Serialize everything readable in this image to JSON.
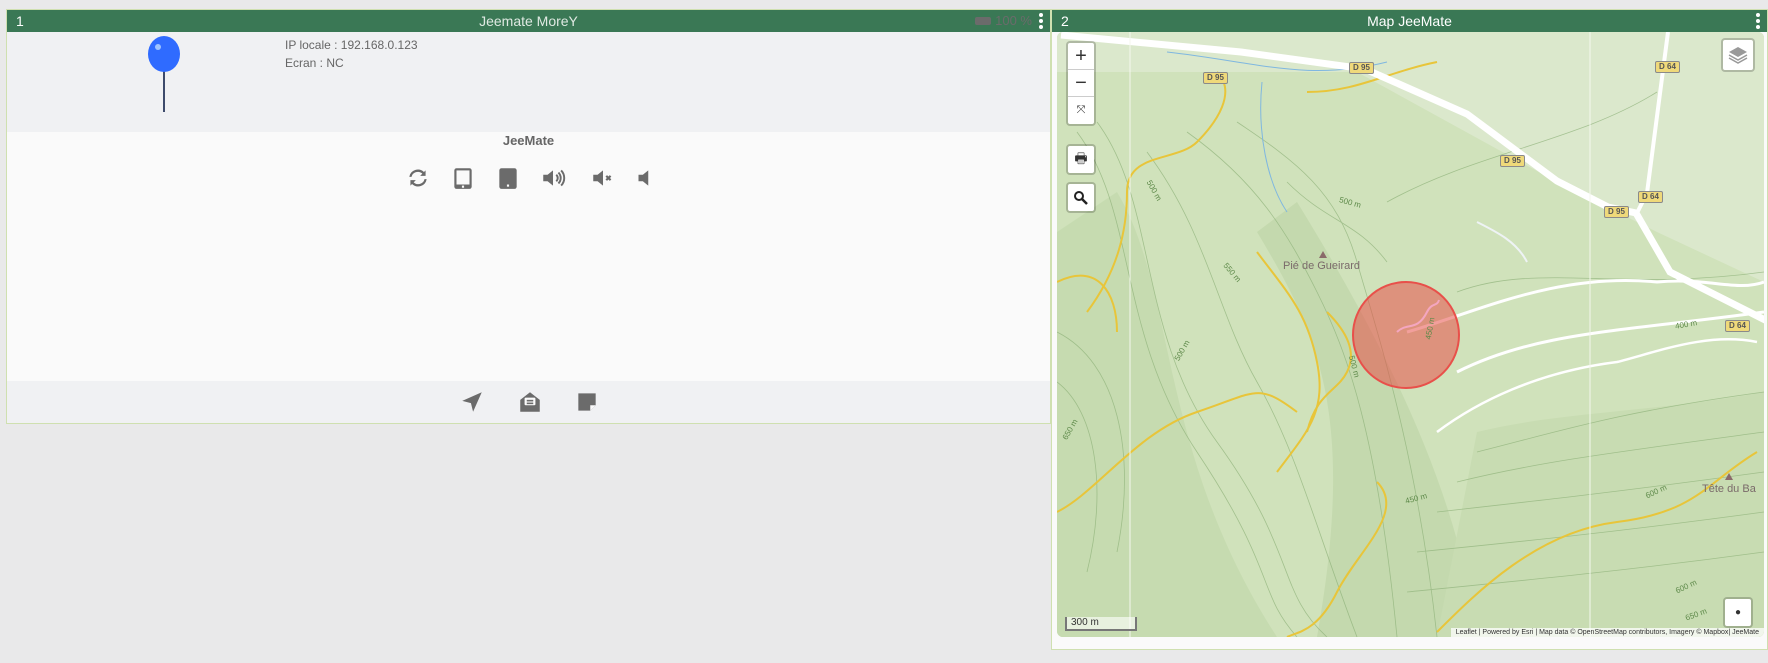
{
  "widget1": {
    "number": "1",
    "title": "Jeemate MoreY",
    "battery": "100 %",
    "ip_line": "IP locale : 192.168.0.123",
    "screen_line": "Ecran : NC",
    "section_title": "JeeMate",
    "actions": [
      "refresh-icon",
      "tablet-outline-icon",
      "tablet-icon",
      "volume-up-icon",
      "volume-mute-icon",
      "volume-off-icon"
    ],
    "footer_actions": [
      "location-arrow-icon",
      "envelope-open-text-icon",
      "sticky-note-icon"
    ],
    "pin_color": "#2f6bff"
  },
  "widget2": {
    "number": "2",
    "title": "Map JeeMate",
    "map": {
      "zoom_in": "+",
      "zoom_out": "−",
      "fullscreen": "⤧",
      "road_labels": [
        "D 95",
        "D 95",
        "D 95",
        "D 95",
        "D 64",
        "D 64",
        "D 64"
      ],
      "places": [
        "Pié de Gueirard",
        "Tête du Ba"
      ],
      "contours": [
        "500 m",
        "500 m",
        "550 m",
        "500 m",
        "500 m",
        "450 m",
        "650 m",
        "400 m",
        "600 m",
        "600 m",
        "450 m",
        "650 m"
      ],
      "scale": "300 m",
      "attribution": "Leaflet | Powered by Esri | Map data © OpenStreetMap contributors, Imagery © Mapbox| JeeMate",
      "circle_color": "#e8504a"
    }
  },
  "colors": {
    "header": "#3a7855",
    "icon": "#6b6b6b"
  }
}
